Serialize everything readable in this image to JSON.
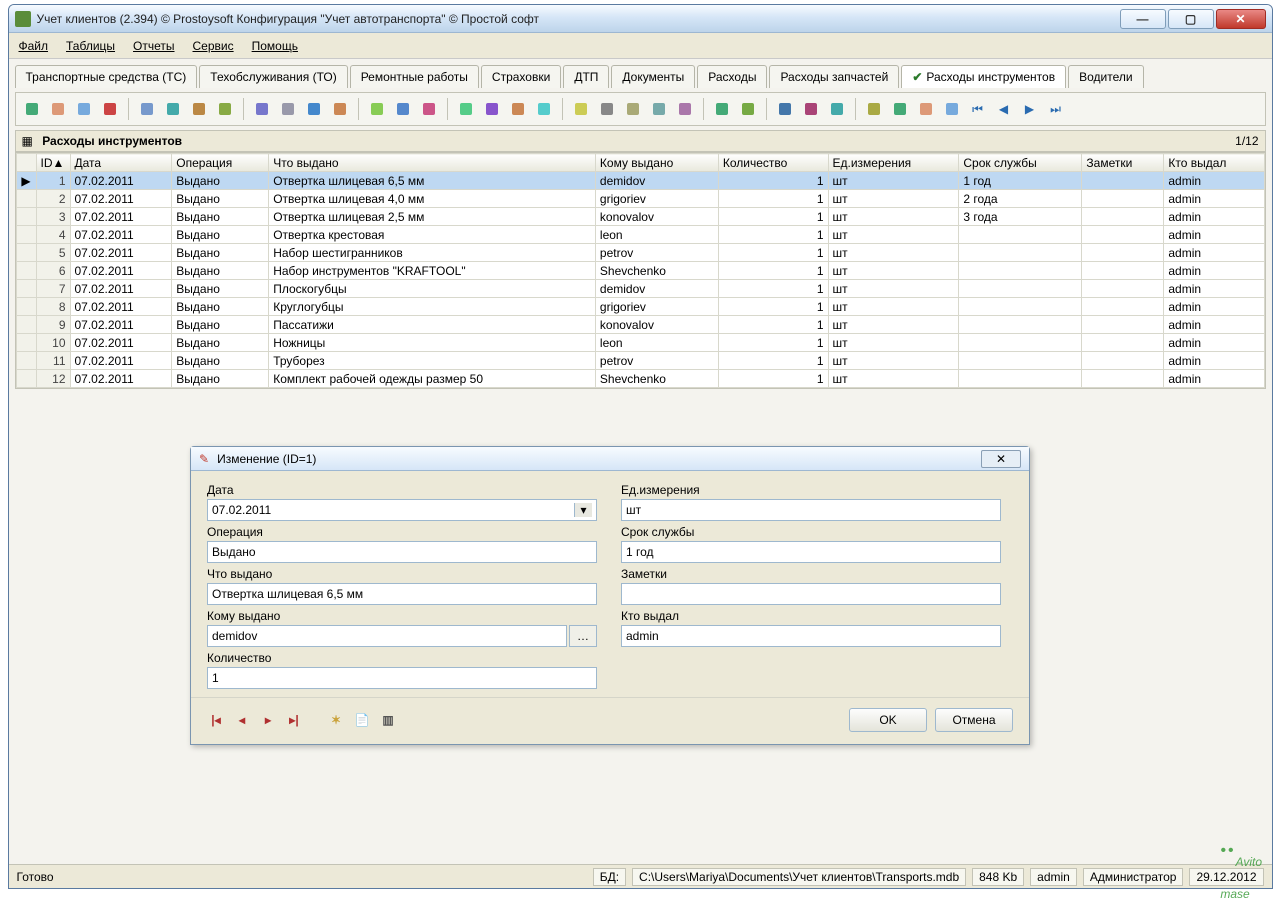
{
  "window": {
    "title": "Учет клиентов (2.394) © Prostoysoft  Конфигурация \"Учет автотранспорта\" © Простой софт"
  },
  "menu": {
    "items": [
      "Файл",
      "Таблицы",
      "Отчеты",
      "Сервис",
      "Помощь"
    ]
  },
  "tabs": {
    "items": [
      "Транспортные средства (ТС)",
      "Техобслуживания (ТО)",
      "Ремонтные работы",
      "Страховки",
      "ДТП",
      "Документы",
      "Расходы",
      "Расходы запчастей",
      "Расходы инструментов",
      "Водители"
    ],
    "active_index": 8
  },
  "table": {
    "caption": "Расходы инструментов",
    "counter": "1/12",
    "columns": [
      "ID▲",
      "Дата",
      "Операция",
      "Что выдано",
      "Кому выдано",
      "Количество",
      "Ед.измерения",
      "Срок службы",
      "Заметки",
      "Кто выдал"
    ],
    "rows": [
      {
        "id": "1",
        "date": "07.02.2011",
        "op": "Выдано",
        "what": "Отвертка шлицевая 6,5 мм",
        "to": "demidov",
        "qty": "1",
        "unit": "шт",
        "life": "1 год",
        "notes": "",
        "by": "admin"
      },
      {
        "id": "2",
        "date": "07.02.2011",
        "op": "Выдано",
        "what": "Отвертка шлицевая 4,0 мм",
        "to": "grigoriev",
        "qty": "1",
        "unit": "шт",
        "life": "2 года",
        "notes": "",
        "by": "admin"
      },
      {
        "id": "3",
        "date": "07.02.2011",
        "op": "Выдано",
        "what": "Отвертка шлицевая 2,5 мм",
        "to": "konovalov",
        "qty": "1",
        "unit": "шт",
        "life": "3 года",
        "notes": "",
        "by": "admin"
      },
      {
        "id": "4",
        "date": "07.02.2011",
        "op": "Выдано",
        "what": "Отвертка крестовая",
        "to": "leon",
        "qty": "1",
        "unit": "шт",
        "life": "",
        "notes": "",
        "by": "admin"
      },
      {
        "id": "5",
        "date": "07.02.2011",
        "op": "Выдано",
        "what": "Набор шестигранников",
        "to": "petrov",
        "qty": "1",
        "unit": "шт",
        "life": "",
        "notes": "",
        "by": "admin"
      },
      {
        "id": "6",
        "date": "07.02.2011",
        "op": "Выдано",
        "what": "Набор инструментов \"KRAFTOOL\"",
        "to": "Shevchenko",
        "qty": "1",
        "unit": "шт",
        "life": "",
        "notes": "",
        "by": "admin"
      },
      {
        "id": "7",
        "date": "07.02.2011",
        "op": "Выдано",
        "what": "Плоскогубцы",
        "to": "demidov",
        "qty": "1",
        "unit": "шт",
        "life": "",
        "notes": "",
        "by": "admin"
      },
      {
        "id": "8",
        "date": "07.02.2011",
        "op": "Выдано",
        "what": "Круглогубцы",
        "to": "grigoriev",
        "qty": "1",
        "unit": "шт",
        "life": "",
        "notes": "",
        "by": "admin"
      },
      {
        "id": "9",
        "date": "07.02.2011",
        "op": "Выдано",
        "what": "Пассатижи",
        "to": "konovalov",
        "qty": "1",
        "unit": "шт",
        "life": "",
        "notes": "",
        "by": "admin"
      },
      {
        "id": "10",
        "date": "07.02.2011",
        "op": "Выдано",
        "what": "Ножницы",
        "to": "leon",
        "qty": "1",
        "unit": "шт",
        "life": "",
        "notes": "",
        "by": "admin"
      },
      {
        "id": "11",
        "date": "07.02.2011",
        "op": "Выдано",
        "what": "Труборез",
        "to": "petrov",
        "qty": "1",
        "unit": "шт",
        "life": "",
        "notes": "",
        "by": "admin"
      },
      {
        "id": "12",
        "date": "07.02.2011",
        "op": "Выдано",
        "what": "Комплект рабочей одежды размер 50",
        "to": "Shevchenko",
        "qty": "1",
        "unit": "шт",
        "life": "",
        "notes": "",
        "by": "admin"
      }
    ]
  },
  "dialog": {
    "title": "Изменение (ID=1)",
    "labels": {
      "date": "Дата",
      "operation": "Операция",
      "what": "Что выдано",
      "whom": "Кому выдано",
      "qty": "Количество",
      "unit": "Ед.измерения",
      "life": "Срок службы",
      "notes": "Заметки",
      "by": "Кто выдал"
    },
    "values": {
      "date": "07.02.2011",
      "operation": "Выдано",
      "what": "Отвертка шлицевая 6,5 мм",
      "whom": "demidov",
      "qty": "1",
      "unit": "шт",
      "life": "1 год",
      "notes": "",
      "by": "admin"
    },
    "ok": "OK",
    "cancel": "Отмена"
  },
  "status": {
    "ready": "Готово",
    "db_label": "БД:",
    "db_path": "C:\\Users\\Mariya\\Documents\\Учет клиентов\\Transports.mdb",
    "size": "848 Kb",
    "user": "admin",
    "role": "Администратор",
    "date": "29.12.2012"
  },
  "watermark": {
    "brand": "Avito",
    "text": "mase"
  }
}
